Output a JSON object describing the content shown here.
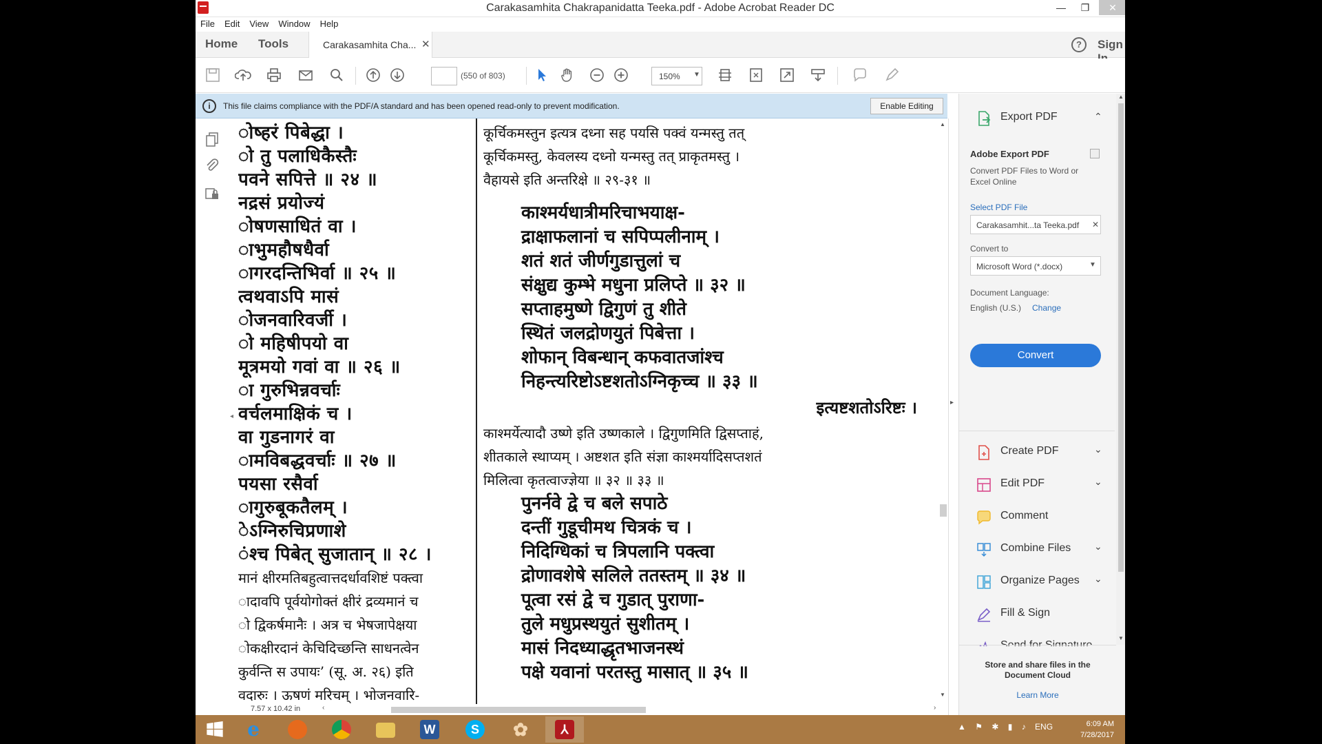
{
  "window": {
    "title": "Carakasamhita Chakrapanidatta Teeka.pdf - Adobe Acrobat Reader DC"
  },
  "menu": [
    "File",
    "Edit",
    "View",
    "Window",
    "Help"
  ],
  "tabs": {
    "home": "Home",
    "tools": "Tools",
    "document": "Carakasamhita Cha...",
    "sign_in": "Sign In"
  },
  "toolbar": {
    "page_count": "(550 of 803)",
    "zoom": "150%"
  },
  "banner": {
    "message": "This file claims compliance with the PDF/A standard and has been opened read-only to prevent modification.",
    "enable_editing": "Enable Editing"
  },
  "document": {
    "left_column": [
      "ोष्हरं पिबेद्धा ।",
      "ो तु पलाधिकैस्तैः",
      "पवने सपित्ते ॥ २४ ॥",
      "नद्रसं प्रयोज्यं",
      "ोषणसाधितं वा ।",
      "ाभुमहौषधैर्वा",
      "ागरदन्तिभिर्वा ॥ २५ ॥",
      "त्वथवाऽपि मासं",
      "ोजनवारिवर्जी ।",
      "ो महिषीपयो वा",
      "मूत्रमयो गवां वा ॥ २६ ॥",
      "ा गुरुभिन्नवर्चाः",
      "वर्चलमाक्षिकं च ।",
      "वा गुडनागरं वा",
      "ामविबद्धवर्चाः ॥ २७ ॥",
      "पयसा रसैर्वा",
      "ागुरुबूकतैलम् ।",
      "ेऽग्निरुचिप्रणाशे",
      "ंश्च पिबेत् सुजातान् ॥ २८ ॥"
    ],
    "left_commentary": [
      "मानं क्षीरमतिबहुत्वात्तदर्धावशिष्टं पक्त्वा",
      "ादावपि पूर्वयोगोक्तं क्षीरं द्रव्यमानं च",
      "ो द्विकर्षमानैः । अत्र च भेषजापेक्षया",
      "ोकक्षीरदानं केचिदिच्छन्ति साधनत्वेन",
      "कुर्वन्ति स उपायः’ (सू. अ. २६) इति",
      "वदारुः । ऊषणं मरिचम् । भोजनवारि-"
    ],
    "right_top": [
      "कूर्चिकमस्तुन इत्यत्र दध्ना सह पयसि पक्वं यन्मस्तु तत्",
      "कूर्चिकमस्तु, केवलस्य दध्नो यन्मस्तु तत् प्राकृतमस्तु ।",
      "वैहायसे इति अन्तरिक्षे ॥ २९-३१ ॥"
    ],
    "verse_a": [
      "काश्मर्यधात्रीमरिचाभयाक्ष-",
      "द्राक्षाफलानां च सपिप्पलीनाम् ।",
      "शतं शतं जीर्णगुडात्तुलां च",
      "संक्षुद्य कुम्भे मधुना प्रलिप्ते ॥ ३२ ॥",
      "सप्ताहमुष्णे द्विगुणं तु शीते",
      "स्थितं जलद्रोणयुतं पिबेत्ता ।",
      "शोफान् विबन्धान् कफवातजांश्च",
      "निहन्त्यरिष्टोऽष्टशतोऽग्निकृच्च ॥ ३३ ॥"
    ],
    "section_heading": "इत्यष्टशतोऽरिष्टः ।",
    "commentary_b": [
      "काश्मर्येत्यादौ उष्णे इति उष्णकाले । द्विगुणमिति द्विसप्ताहं,",
      "शीतकाले स्थाप्यम् । अष्टशत इति संज्ञा काश्मर्यादिसप्तशतं",
      "मिलित्वा कृतत्वाज्ज्ञेया ॥ ३२ ॥ ३३ ॥"
    ],
    "verse_b": [
      "पुनर्नवे द्वे च बले सपाठे",
      "दन्तीं गुडूचीमथ चित्रकं च ।",
      "निदिग्धिकां च त्रिपलानि पक्त्वा",
      "द्रोणावशेषे सलिले ततस्तम् ॥ ३४ ॥",
      "पूत्वा रसं द्वे च गुडात् पुराणा-",
      "तुले मधुप्रस्थयुतं सुशीतम् ।",
      "मासं निदध्याद्धृतभाजनस्थं",
      "पक्षे यवानां परतस्तु मासात् ॥ ३५ ॥"
    ]
  },
  "status": {
    "page_size": "7.57 x 10.42 in"
  },
  "right_panel": {
    "export_pdf": "Export PDF",
    "adobe_export_title": "Adobe Export PDF",
    "adobe_export_desc": "Convert PDF Files to Word or Excel Online",
    "select_pdf": "Select PDF File",
    "file_name": "Carakasamhit...ta Teeka.pdf",
    "convert_to": "Convert to",
    "format": "Microsoft Word (*.docx)",
    "doc_language": "Document Language:",
    "language_value": "English (U.S.)",
    "change": "Change",
    "convert_button": "Convert",
    "tools": [
      {
        "label": "Create PDF",
        "icon": "create-pdf-icon",
        "color": "#e0504a"
      },
      {
        "label": "Edit PDF",
        "icon": "edit-pdf-icon",
        "color": "#d9488b"
      },
      {
        "label": "Comment",
        "icon": "comment-icon",
        "color": "#f0b82c"
      },
      {
        "label": "Combine Files",
        "icon": "combine-files-icon",
        "color": "#3b8ed6"
      },
      {
        "label": "Organize Pages",
        "icon": "organize-pages-icon",
        "color": "#45a6d8"
      },
      {
        "label": "Fill & Sign",
        "icon": "fill-sign-icon",
        "color": "#7a5fc8"
      },
      {
        "label": "Send for Signature",
        "icon": "send-signature-icon",
        "color": "#7a5fc8"
      }
    ],
    "store_text": "Store and share files in the Document Cloud",
    "learn_more": "Learn More"
  },
  "taskbar": {
    "apps": [
      {
        "name": "start",
        "color": "#ffffff"
      },
      {
        "name": "internet-explorer",
        "color": "#2a8fe0"
      },
      {
        "name": "firefox",
        "color": "#e66a1d"
      },
      {
        "name": "chrome",
        "color": "#3b9d45"
      },
      {
        "name": "file-explorer",
        "color": "#e8c45a"
      },
      {
        "name": "word",
        "color": "#2b5797"
      },
      {
        "name": "skype",
        "color": "#00aff0"
      },
      {
        "name": "app-flower",
        "color": "#d88a3b"
      },
      {
        "name": "acrobat-reader",
        "color": "#b0191e"
      }
    ],
    "tray_lang": "ENG",
    "time": "6:09 AM",
    "date": "7/28/2017"
  }
}
